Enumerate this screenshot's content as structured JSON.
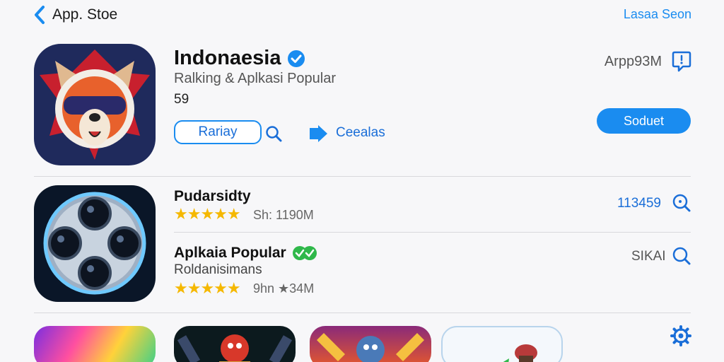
{
  "topbar": {
    "back_label": "App. Stoe",
    "link_label": "Lasaa Seon"
  },
  "hero": {
    "title": "Indonaesia",
    "subtitle": "Ralking & Aplkasi Popular",
    "number": "59",
    "pill_label": "Rariay",
    "share_label": "Ceealas",
    "size_label": "Arpp93M",
    "get_label": "Soduet"
  },
  "rows": [
    {
      "title": "Pudarsidty",
      "stars": "★★★★★",
      "meta": "Sh: 1190M",
      "right": "113459",
      "right_color": "#1a6ed8"
    },
    {
      "title": "Aplkaia Popular",
      "subtitle": "Roldanisimans",
      "stars": "★★★★★",
      "meta": "9hn ★34M",
      "right": "SIKAI",
      "right_color": "#555555"
    }
  ],
  "colors": {
    "accent": "#1a8cf0",
    "star": "#f5b800",
    "verified_green": "#2fb84a"
  },
  "icons": [
    "back-chevron-icon",
    "verified-badge-icon",
    "search-icon",
    "share-arrow-icon",
    "chat-bubble-icon",
    "green-badge-icon",
    "gear-icon"
  ]
}
